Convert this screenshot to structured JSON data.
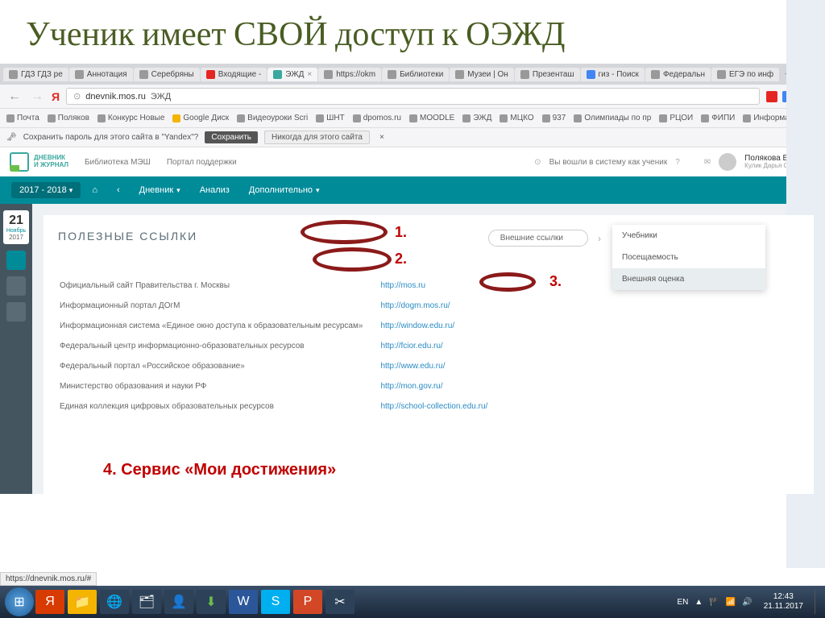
{
  "title": "Ученик имеет СВОЙ доступ к ОЭЖД",
  "tabs": [
    "ГДЗ ГДЗ ре",
    "Аннотация",
    "Серебряны",
    "Входящие -",
    "ЭЖД",
    "https://okm",
    "Библиотеки",
    "Музеи | Он",
    "Презенташ",
    "гиз - Поиск",
    "Федеральн",
    "ЕГЭ по инф"
  ],
  "url": {
    "host": "dnevnik.mos.ru",
    "path": "ЭЖД"
  },
  "bookmarks": [
    "Почта",
    "Поляков",
    "Конкурс Новые",
    "Google Диск",
    "Видеоуроки Scri",
    "ШНТ",
    "dpomos.ru",
    "MOODLE",
    "ЭЖД",
    "МЦКО",
    "937",
    "Олимпиады по пр",
    "РЦОИ",
    "ФИПИ",
    "Информатик БУ"
  ],
  "savepw": {
    "text": "Сохранить пароль для этого сайта в \"Yandex\"?",
    "save": "Сохранить",
    "never": "Никогда для этого сайта"
  },
  "header": {
    "lib": "Библиотека МЭШ",
    "portal": "Портал поддержки",
    "login": "Вы вошли в систему как ученик",
    "user1": "Полякова В. П.",
    "user2": "Кулик Дарья Сергеевна"
  },
  "nav": {
    "year": "2017 - 2018",
    "diary": "Дневник",
    "analysis": "Анализ",
    "extra": "Дополнительно"
  },
  "cal": {
    "day": "21",
    "month": "Ноябрь",
    "year": "2017"
  },
  "panel": {
    "title": "ПОЛЕЗНЫЕ ССЫЛКИ",
    "pill": "Внешние ссылки"
  },
  "dropdown": [
    "Учебники",
    "Посещаемость",
    "Внешняя оценка"
  ],
  "links": [
    {
      "name": "Официальный сайт Правительства г. Москвы",
      "url": "http://mos.ru"
    },
    {
      "name": "Информационный портал ДОгМ",
      "url": "http://dogm.mos.ru/"
    },
    {
      "name": "Информационная система «Единое окно доступа к образовательным ресурсам»",
      "url": "http://window.edu.ru/"
    },
    {
      "name": "Федеральный центр информационно-образовательных ресурсов",
      "url": "http://fcior.edu.ru/"
    },
    {
      "name": "Федеральный портал «Российское образование»",
      "url": "http://www.edu.ru/"
    },
    {
      "name": "Министерство образования и науки РФ",
      "url": "http://mon.gov.ru/"
    },
    {
      "name": "Единая коллекция цифровых образовательных ресурсов",
      "url": "http://school-collection.edu.ru/"
    }
  ],
  "annot": {
    "a1": "1.",
    "a2": "2.",
    "a3": "3.",
    "a4": "4. Сервис «Мои достижения»"
  },
  "status_url": "https://dnevnik.mos.ru/#",
  "systray": {
    "lang": "EN",
    "time": "12:43",
    "date": "21.11.2017"
  }
}
